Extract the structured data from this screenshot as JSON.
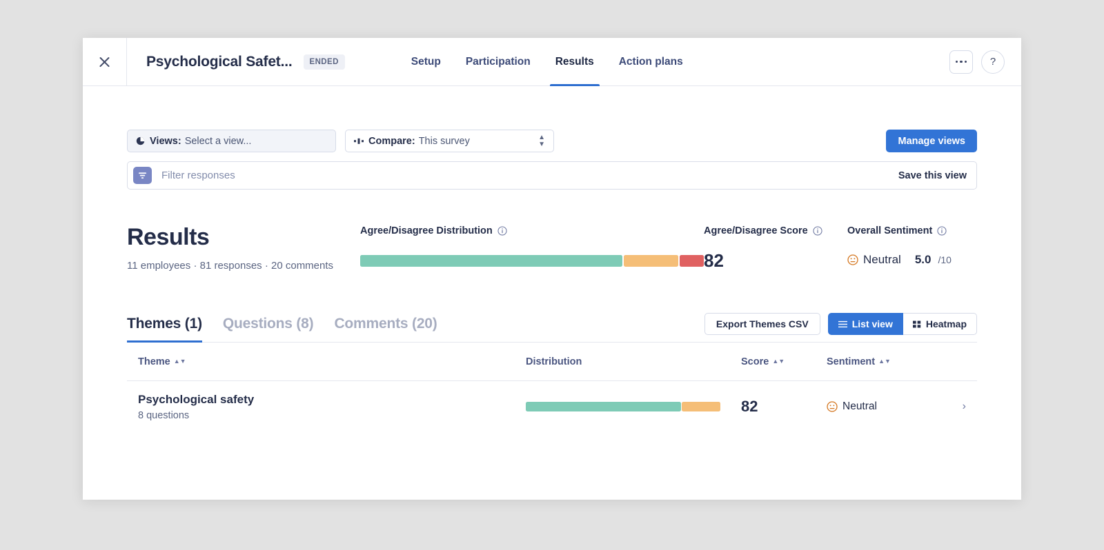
{
  "header": {
    "close_icon": "close-icon",
    "title": "Psychological Safet...",
    "status_badge": "ENDED",
    "tabs": [
      {
        "label": "Setup",
        "active": false
      },
      {
        "label": "Participation",
        "active": false
      },
      {
        "label": "Results",
        "active": true
      },
      {
        "label": "Action plans",
        "active": false
      }
    ],
    "more_icon": "ellipsis-icon",
    "help_label": "?"
  },
  "toolbar": {
    "views_icon": "pie-chart-icon",
    "views_label": "Views:",
    "views_value": "Select a view...",
    "compare_icon": "compare-icon",
    "compare_label": "Compare:",
    "compare_value": "This survey",
    "manage_views_label": "Manage views"
  },
  "filter": {
    "icon": "funnel-icon",
    "placeholder": "Filter responses",
    "save_label": "Save this view"
  },
  "summary": {
    "title": "Results",
    "subtitle": "11 employees · 81 responses · 20 comments",
    "distribution_label": "Agree/Disagree Distribution",
    "score_label": "Agree/Disagree Score",
    "score_value": "82",
    "sentiment_label": "Overall Sentiment",
    "sentiment_face": "neutral-face-icon",
    "sentiment_text": "Neutral",
    "sentiment_value": "5.0",
    "sentiment_denominator": "/10"
  },
  "content_tabs": [
    {
      "label": "Themes (1)",
      "active": true
    },
    {
      "label": "Questions (8)",
      "active": false
    },
    {
      "label": "Comments (20)",
      "active": false
    }
  ],
  "actions": {
    "export_label": "Export Themes CSV",
    "list_view_label": "List view",
    "list_view_icon": "list-icon",
    "heatmap_label": "Heatmap",
    "heatmap_icon": "grid-icon",
    "list_view_active": true
  },
  "table": {
    "columns": [
      {
        "label": "Theme",
        "sortable": true
      },
      {
        "label": "Distribution",
        "sortable": false
      },
      {
        "label": "Score",
        "sortable": true
      },
      {
        "label": "Sentiment",
        "sortable": true
      }
    ],
    "rows": [
      {
        "name": "Psychological safety",
        "questions": "8 questions",
        "score": "82",
        "sentiment_face": "neutral-face-icon",
        "sentiment": "Neutral",
        "chevron": "chevron-right-icon"
      }
    ]
  },
  "chart_data": {
    "type": "bar",
    "title": "Agree/Disagree Distribution",
    "orientation": "horizontal-stacked",
    "summary_bar": {
      "categories": [
        "Agree",
        "Neutral",
        "Disagree"
      ],
      "values": [
        77,
        16,
        7
      ],
      "unit": "percent"
    },
    "theme_bar": {
      "categories": [
        "Agree",
        "Neutral",
        "Disagree"
      ],
      "values": [
        80,
        20,
        0
      ],
      "unit": "percent"
    }
  },
  "colors": {
    "agree": "#7ecbb6",
    "neutral": "#f5be77",
    "disagree": "#e06161",
    "accent": "#3274d6",
    "text": "#242d49",
    "muted": "#5b6582",
    "border": "#e4e7ee"
  }
}
